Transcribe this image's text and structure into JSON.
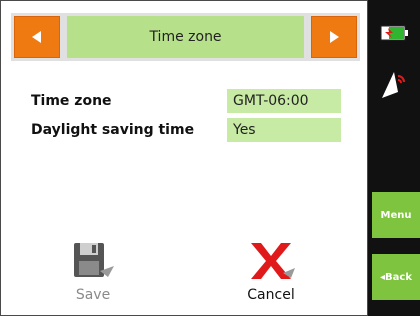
{
  "header": {
    "title": "Time zone",
    "prev_icon": "left-arrow-icon",
    "next_icon": "right-arrow-icon",
    "accent_color": "#f07a12",
    "title_bg": "#b6e08a"
  },
  "settings": [
    {
      "label": "Time zone",
      "value": "GMT-06:00"
    },
    {
      "label": "Daylight saving time",
      "value": "Yes"
    }
  ],
  "actions": {
    "save_label": "Save",
    "save_icon": "floppy-disk-icon",
    "cancel_label": "Cancel",
    "cancel_icon": "red-x-icon"
  },
  "sidebar": {
    "battery_icon": "battery-icon",
    "gps_icon": "gps-signal-icon",
    "menu_label": "Menu",
    "back_label": "◂Back",
    "button_color": "#7ec43f"
  }
}
